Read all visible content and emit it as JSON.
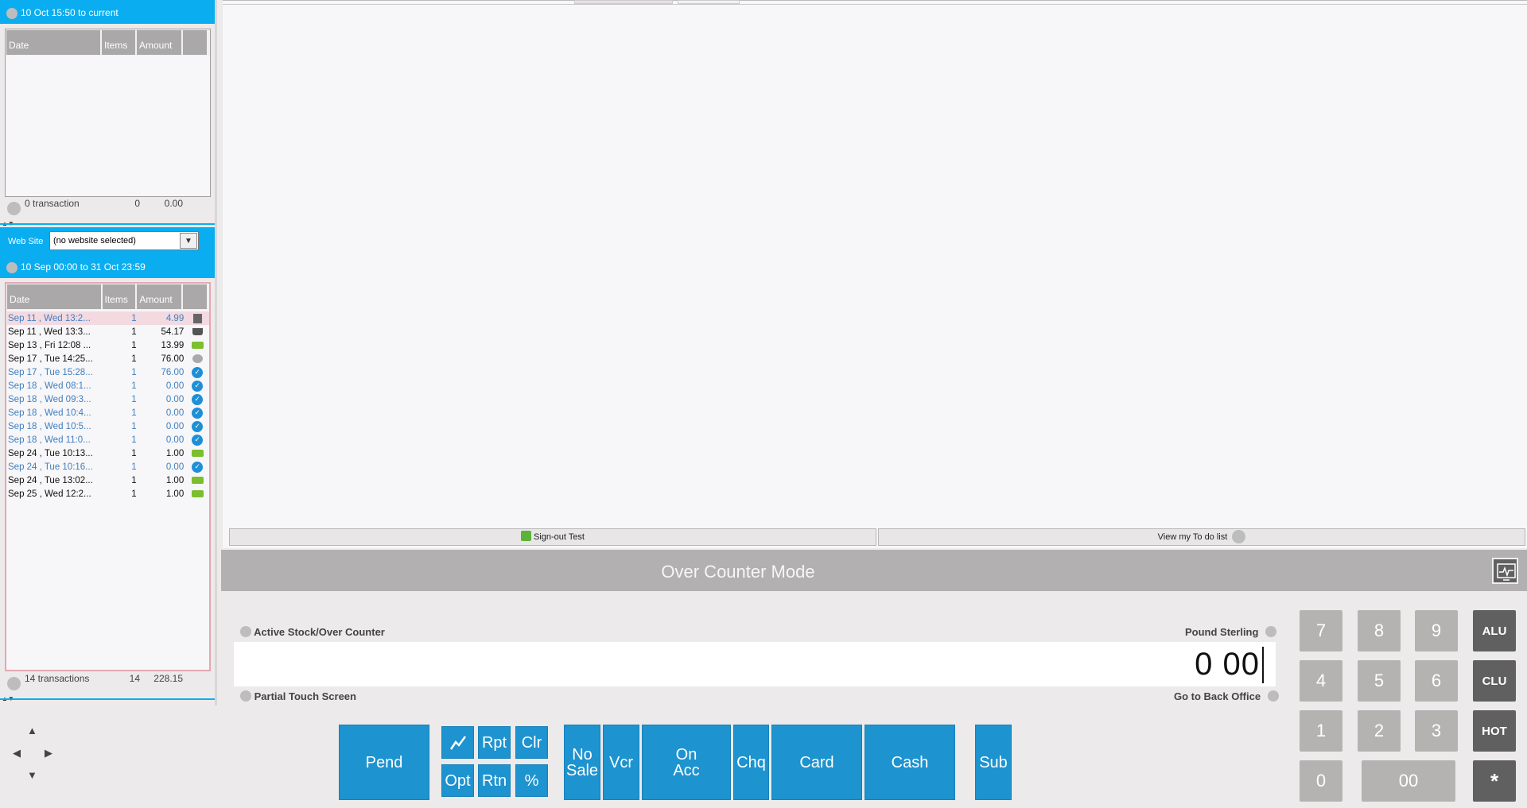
{
  "session": {
    "range": "10 Oct 15:50 to current",
    "headers": {
      "date": "Date",
      "items": "Items",
      "amount": "Amount"
    },
    "summary": {
      "label": "0 transaction",
      "count": "0",
      "amount": "0.00"
    }
  },
  "website": {
    "label": "Web Site",
    "selected": "(no website selected)",
    "range": "10 Sep 00:00 to 31 Oct 23:59",
    "headers": {
      "date": "Date",
      "items": "Items",
      "amount": "Amount"
    },
    "rows": [
      {
        "date": "Sep 11 , Wed  13:2...",
        "items": "1",
        "amount": "4.99",
        "icon": "grid-icon",
        "style": "sel"
      },
      {
        "date": "Sep 11 , Wed  13:3...",
        "items": "1",
        "amount": "54.17",
        "icon": "basket-icon",
        "style": "dark"
      },
      {
        "date": "Sep 13 , Fri  12:08 ...",
        "items": "1",
        "amount": "13.99",
        "icon": "truck-icon",
        "style": "dark"
      },
      {
        "date": "Sep 17 , Tue  14:25...",
        "items": "1",
        "amount": "76.00",
        "icon": "pending-icon",
        "style": "dark"
      },
      {
        "date": "Sep 17 , Tue  15:28...",
        "items": "1",
        "amount": "76.00",
        "icon": "check-icon",
        "style": "blue"
      },
      {
        "date": "Sep 18 , Wed  08:1...",
        "items": "1",
        "amount": "0.00",
        "icon": "check-icon",
        "style": "blue"
      },
      {
        "date": "Sep 18 , Wed  09:3...",
        "items": "1",
        "amount": "0.00",
        "icon": "check-icon",
        "style": "blue"
      },
      {
        "date": "Sep 18 , Wed  10:4...",
        "items": "1",
        "amount": "0.00",
        "icon": "check-icon",
        "style": "blue"
      },
      {
        "date": "Sep 18 , Wed  10:5...",
        "items": "1",
        "amount": "0.00",
        "icon": "check-icon",
        "style": "blue"
      },
      {
        "date": "Sep 18 , Wed  11:0...",
        "items": "1",
        "amount": "0.00",
        "icon": "check-icon",
        "style": "blue"
      },
      {
        "date": "Sep 24 , Tue  10:13...",
        "items": "1",
        "amount": "1.00",
        "icon": "truck-icon",
        "style": "dark"
      },
      {
        "date": "Sep 24 , Tue  10:16...",
        "items": "1",
        "amount": "0.00",
        "icon": "check-icon",
        "style": "blue"
      },
      {
        "date": "Sep 24 , Tue  13:02...",
        "items": "1",
        "amount": "1.00",
        "icon": "truck-icon",
        "style": "dark"
      },
      {
        "date": "Sep 25 , Wed  12:2...",
        "items": "1",
        "amount": "1.00",
        "icon": "truck-icon",
        "style": "dark"
      }
    ],
    "summary": {
      "label": "14 transactions",
      "count": "14",
      "amount": "228.15"
    }
  },
  "buttons": {
    "signout": "Sign-out Test",
    "todo": "View my To do list"
  },
  "mode": {
    "title": "Over Counter Mode"
  },
  "till": {
    "active_stock": "Active Stock/Over Counter",
    "partial": "Partial Touch Screen",
    "currency": "Pound Sterling",
    "back_office": "Go to Back Office",
    "amount": "0 00"
  },
  "pos": {
    "pend": "Pend",
    "rpt": "Rpt",
    "clr": "Clr",
    "opt": "Opt",
    "rtn": "Rtn",
    "pct": "%",
    "nosale_1": "No",
    "nosale_2": "Sale",
    "vcr": "Vcr",
    "onacc_1": "On",
    "onacc_2": "Acc",
    "chq": "Chq",
    "card": "Card",
    "cash": "Cash",
    "sub": "Sub"
  },
  "keypad": {
    "k7": "7",
    "k8": "8",
    "k9": "9",
    "alu": "ALU",
    "k4": "4",
    "k5": "5",
    "k6": "6",
    "clu": "CLU",
    "k1": "1",
    "k2": "2",
    "k3": "3",
    "hot": "HOT",
    "k0": "0",
    "k00": "00",
    "star": "*"
  },
  "colors": {
    "accent": "#0aaef0",
    "pos_button": "#1d93cf",
    "key": "#b5b2b2",
    "key_dark": "#606060"
  }
}
